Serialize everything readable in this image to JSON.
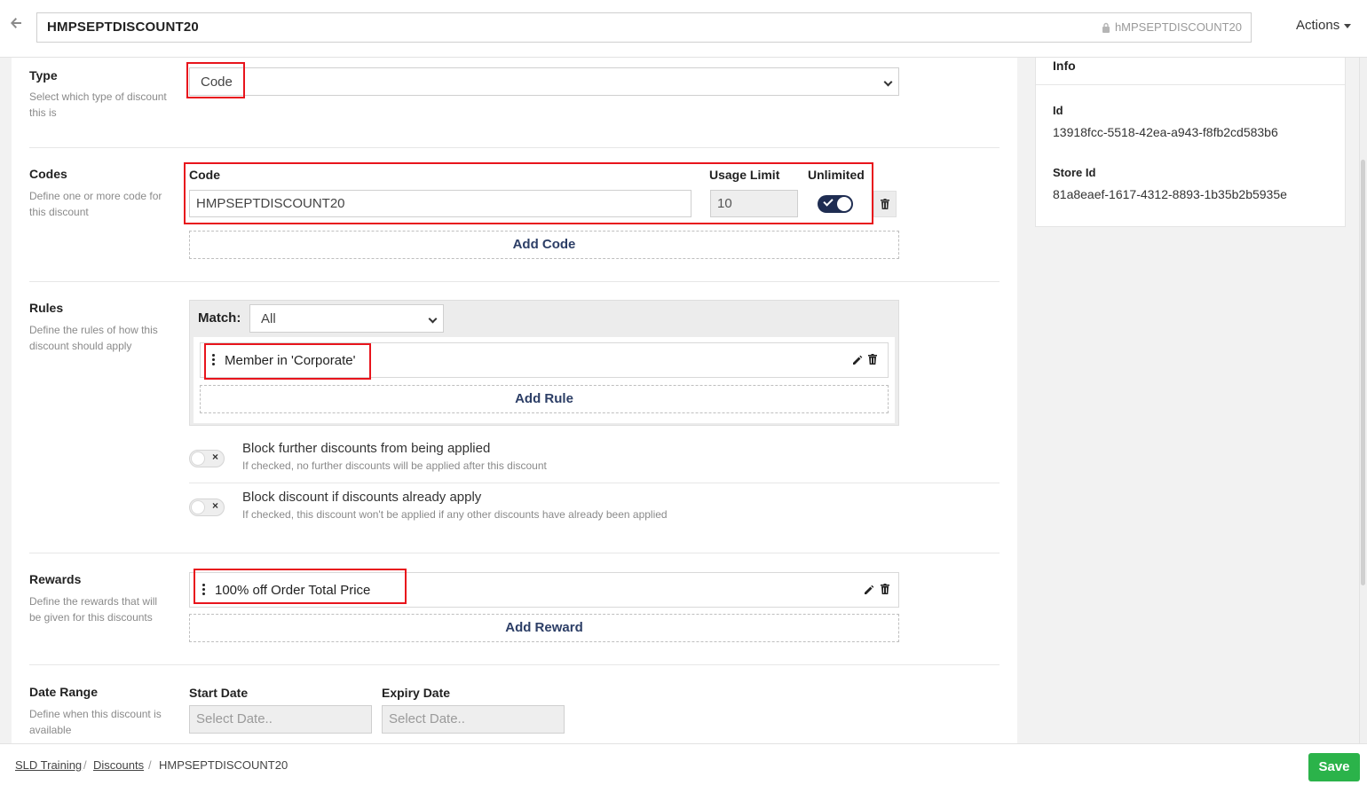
{
  "header": {
    "title": "HMPSEPTDISCOUNT20",
    "slug": "hMPSEPTDISCOUNT20",
    "actions_label": "Actions"
  },
  "type_section": {
    "title": "Type",
    "description": "Select which type of discount this is",
    "selected": "Code"
  },
  "codes_section": {
    "title": "Codes",
    "description": "Define one or more code for this discount",
    "code_label": "Code",
    "usage_limit_label": "Usage Limit",
    "unlimited_label": "Unlimited",
    "code_value": "HMPSEPTDISCOUNT20",
    "usage_limit_value": "10",
    "unlimited_on": true,
    "add_code_label": "Add Code"
  },
  "rules_section": {
    "title": "Rules",
    "description": "Define the rules of how this discount should apply",
    "match_label": "Match:",
    "match_value": "All",
    "rules": [
      "Member in 'Corporate'"
    ],
    "add_rule_label": "Add Rule",
    "block_further": {
      "title": "Block further discounts from being applied",
      "description": "If checked, no further discounts will be applied after this discount"
    },
    "block_if_applied": {
      "title": "Block discount if discounts already apply",
      "description": "If checked, this discount won't be applied if any other discounts have already been applied"
    }
  },
  "rewards_section": {
    "title": "Rewards",
    "description": "Define the rewards that will be given for this discounts",
    "rewards": [
      "100% off Order Total Price"
    ],
    "add_reward_label": "Add Reward"
  },
  "date_section": {
    "title": "Date Range",
    "description": "Define when this discount is available",
    "start_label": "Start Date",
    "expiry_label": "Expiry Date",
    "start_placeholder": "Select Date..",
    "expiry_placeholder": "Select Date.."
  },
  "info": {
    "title": "Info",
    "id_label": "Id",
    "id_value": "13918fcc-5518-42ea-a943-f8fb2cd583b6",
    "store_id_label": "Store Id",
    "store_id_value": "81a8eaef-1617-4312-8893-1b35b2b5935e"
  },
  "footer": {
    "breadcrumbs": [
      "SLD Training",
      "Discounts",
      "HMPSEPTDISCOUNT20"
    ],
    "save_label": "Save"
  },
  "colors": {
    "accent": "#1f2d52",
    "save": "#2bb34a",
    "highlight": "#e8141c"
  }
}
